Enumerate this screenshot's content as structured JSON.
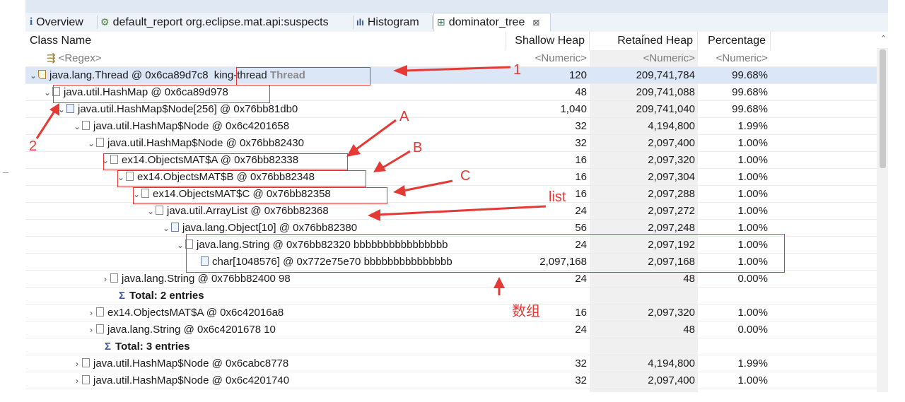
{
  "tabs": [
    {
      "icon": "info-icon",
      "label": "Overview"
    },
    {
      "icon": "report-icon",
      "label": "default_report  org.eclipse.mat.api:suspects"
    },
    {
      "icon": "histogram-icon",
      "label": "Histogram"
    },
    {
      "icon": "tree-icon",
      "label": "dominator_tree"
    }
  ],
  "tab_close_glyph": "⊠",
  "columns": {
    "name": "Class Name",
    "shallow": "Shallow Heap",
    "retained": "Retained Heap",
    "percent": "Percentage"
  },
  "filter": {
    "name": "<Regex>",
    "shallow": "<Numeric>",
    "retained": "<Numeric>",
    "percent": "<Numeric>"
  },
  "rows": [
    {
      "name": "java.lang.Thread @ 0x6ca89d7c8",
      "extra": "king-thread",
      "extra2": "Thread",
      "shallow": "120",
      "retained": "209,741,784",
      "percent": "99.68%"
    },
    {
      "name": "java.util.HashMap @ 0x6ca89d978",
      "shallow": "48",
      "retained": "209,741,088",
      "percent": "99.68%"
    },
    {
      "name": "java.util.HashMap$Node[256] @ 0x76bb81db0",
      "shallow": "1,040",
      "retained": "209,741,040",
      "percent": "99.68%"
    },
    {
      "name": "java.util.HashMap$Node @ 0x6c4201658",
      "shallow": "32",
      "retained": "4,194,800",
      "percent": "1.99%"
    },
    {
      "name": "java.util.HashMap$Node @ 0x76bb82430",
      "shallow": "32",
      "retained": "2,097,400",
      "percent": "1.00%"
    },
    {
      "name": "ex14.ObjectsMAT$A @ 0x76bb82338",
      "shallow": "16",
      "retained": "2,097,320",
      "percent": "1.00%"
    },
    {
      "name": "ex14.ObjectsMAT$B @ 0x76bb82348",
      "shallow": "16",
      "retained": "2,097,304",
      "percent": "1.00%"
    },
    {
      "name": "ex14.ObjectsMAT$C @ 0x76bb82358",
      "shallow": "16",
      "retained": "2,097,288",
      "percent": "1.00%"
    },
    {
      "name": "java.util.ArrayList @ 0x76bb82368",
      "shallow": "24",
      "retained": "2,097,272",
      "percent": "1.00%"
    },
    {
      "name": "java.lang.Object[10] @ 0x76bb82380",
      "shallow": "56",
      "retained": "2,097,248",
      "percent": "1.00%"
    },
    {
      "name": "java.lang.String @ 0x76bb82320  bbbbbbbbbbbbbbbb",
      "shallow": "24",
      "retained": "2,097,192",
      "percent": "1.00%"
    },
    {
      "name": "char[1048576] @ 0x772e75e70  bbbbbbbbbbbbbbb",
      "shallow": "2,097,168",
      "retained": "2,097,168",
      "percent": "1.00%"
    },
    {
      "name": "java.lang.String @ 0x76bb82400  98",
      "shallow": "24",
      "retained": "48",
      "percent": "0.00%"
    },
    {
      "name": "Total: 2 entries",
      "shallow": "",
      "retained": "",
      "percent": ""
    },
    {
      "name": "ex14.ObjectsMAT$A @ 0x6c42016a8",
      "shallow": "16",
      "retained": "2,097,320",
      "percent": "1.00%"
    },
    {
      "name": "java.lang.String @ 0x6c4201678  10",
      "shallow": "24",
      "retained": "48",
      "percent": "0.00%"
    },
    {
      "name": "Total: 3 entries",
      "shallow": "",
      "retained": "",
      "percent": ""
    },
    {
      "name": "java.util.HashMap$Node @ 0x6cabc8778",
      "shallow": "32",
      "retained": "4,194,800",
      "percent": "1.99%"
    },
    {
      "name": "java.util.HashMap$Node @ 0x6c4201740",
      "shallow": "32",
      "retained": "2,097,400",
      "percent": "1.00%"
    }
  ],
  "annotations": {
    "n1": "1",
    "n2": "2",
    "a": "A",
    "b": "B",
    "c": "C",
    "list": "list",
    "array": "数组"
  },
  "colors": {
    "annotation": "#e53935",
    "selection": "#dbe6f6",
    "tab_bar": "#eef3fa"
  }
}
